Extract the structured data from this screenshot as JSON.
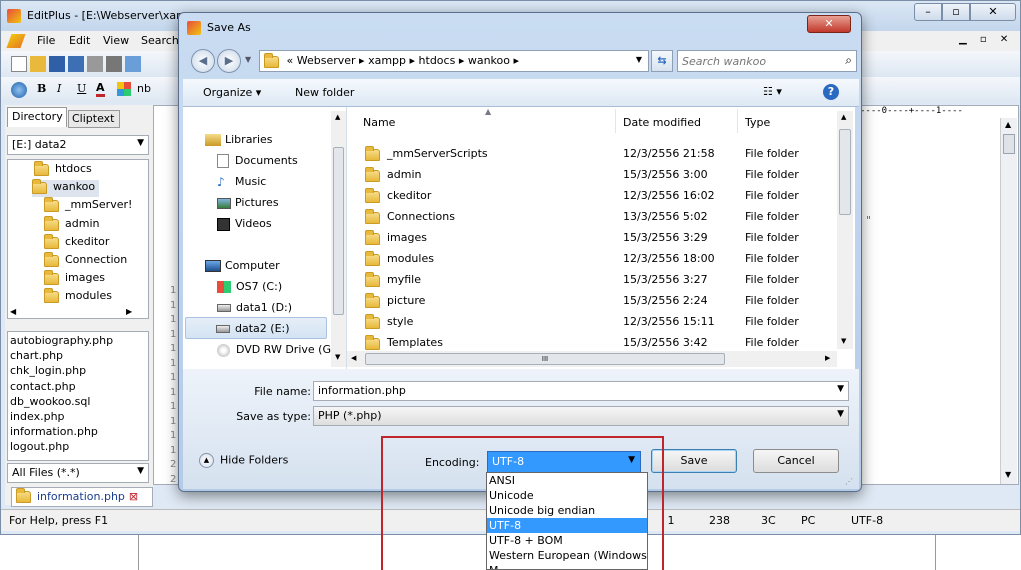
{
  "editplus": {
    "title": "EditPlus - [E:\\Webserver\\xam",
    "menu": [
      "File",
      "Edit",
      "View",
      "Search"
    ],
    "sidebar_tabs": [
      "Directory",
      "Cliptext"
    ],
    "drive": "[E:] data2",
    "tree": [
      "htdocs",
      "wankoo",
      "_mmServer!",
      "admin",
      "ckeditor",
      "Connection",
      "images",
      "modules"
    ],
    "files": [
      "autobiography.php",
      "chart.php",
      "chk_login.php",
      "contact.php",
      "db_wookoo.sql",
      "index.php",
      "information.php",
      "logout.php"
    ],
    "filter": "All Files (*.*)",
    "doc_tab": "information.php",
    "status_help": "For Help, press F1",
    "status_cells": [
      "l 1",
      "238",
      "3C",
      "PC",
      "UTF-8"
    ],
    "ruler": "----0----+----1----",
    "gutter": [
      "1",
      "1",
      "1",
      "1",
      "1",
      "1",
      "1",
      "1",
      "1",
      "1",
      "1",
      "1",
      "2",
      "2"
    ],
    "code_char": "\""
  },
  "dialog": {
    "title": "Save As",
    "breadcrumb": [
      "« Webserver",
      "xampp",
      "htdocs",
      "wankoo"
    ],
    "search_placeholder": "Search wankoo",
    "organize": "Organize ▾",
    "new_folder": "New folder",
    "nav": {
      "libraries": "Libraries",
      "lib_items": [
        "Documents",
        "Music",
        "Pictures",
        "Videos"
      ],
      "computer": "Computer",
      "drives": [
        "OS7 (C:)",
        "data1 (D:)",
        "data2 (E:)",
        "DVD RW Drive (G"
      ]
    },
    "columns": [
      "Name",
      "Date modified",
      "Type"
    ],
    "rows": [
      {
        "name": "_mmServerScripts",
        "date": "12/3/2556 21:58",
        "type": "File folder"
      },
      {
        "name": "admin",
        "date": "15/3/2556 3:00",
        "type": "File folder"
      },
      {
        "name": "ckeditor",
        "date": "12/3/2556 16:02",
        "type": "File folder"
      },
      {
        "name": "Connections",
        "date": "13/3/2556 5:02",
        "type": "File folder"
      },
      {
        "name": "images",
        "date": "15/3/2556 3:29",
        "type": "File folder"
      },
      {
        "name": "modules",
        "date": "12/3/2556 18:00",
        "type": "File folder"
      },
      {
        "name": "myfile",
        "date": "15/3/2556 3:27",
        "type": "File folder"
      },
      {
        "name": "picture",
        "date": "15/3/2556 2:24",
        "type": "File folder"
      },
      {
        "name": "style",
        "date": "12/3/2556 15:11",
        "type": "File folder"
      },
      {
        "name": "Templates",
        "date": "15/3/2556 3:42",
        "type": "File folder"
      }
    ],
    "file_name_label": "File name:",
    "file_name": "information.php",
    "save_type_label": "Save as type:",
    "save_type": "PHP (*.php)",
    "hide_folders": "Hide Folders",
    "encoding_label": "Encoding:",
    "encoding": "UTF-8",
    "encoding_options": [
      "ANSI",
      "Unicode",
      "Unicode big endian",
      "UTF-8",
      "UTF-8 + BOM",
      "Western European (Windows)",
      "M"
    ],
    "encoding_selected_index": 3,
    "save": "Save",
    "cancel": "Cancel",
    "close_glyph": "✕",
    "hscroll_glyph": "III"
  },
  "colors": {
    "accent": "#3399ff",
    "highlight_box": "#c0252b",
    "title_glass": "#c5d9f1"
  }
}
